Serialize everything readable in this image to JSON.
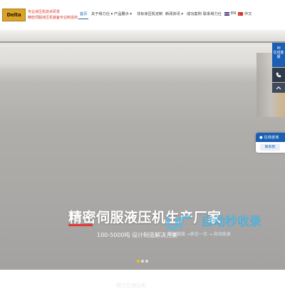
{
  "brand": {
    "logo_text": "Delta",
    "slogan_line1": "专业液压机技术研发",
    "slogan_line2": "精密伺服液压机装备专业制造商"
  },
  "nav": {
    "items": [
      "首页",
      "关于得力仕 ▾",
      "产品展示 ▾",
      "非标液压机定制",
      "新闻资讯 ▾",
      "成功案例",
      "联系得力仕"
    ],
    "lang_en": "EN",
    "lang_cn": "中文"
  },
  "banner": {
    "title": "精密伺服液压机生产厂家",
    "subtitle": "100-5000吨 设计制造解决方案",
    "slides": 3,
    "active_slide": 1
  },
  "float_widget": {
    "online_label": "在线客服",
    "consult_title": "在线咨询",
    "consult_button": "联系我"
  },
  "watermark": {
    "title": "自动秒收录",
    "sub": "做上链接 →来访一次 → 自动收录"
  },
  "bottom": {
    "faint_text": "得力仕液压机"
  },
  "colors": {
    "primary": "#1a5fb4",
    "accent_red": "#e53935",
    "logo_gold": "#d9a22a",
    "slide_dot_active": "#f5c400"
  }
}
